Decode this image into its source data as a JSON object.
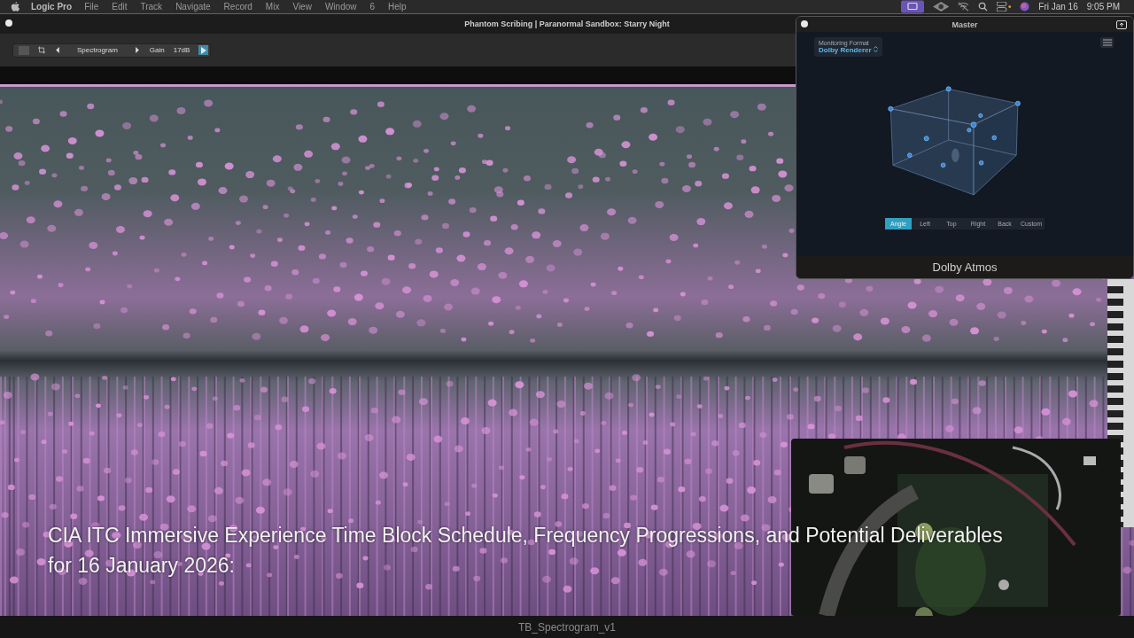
{
  "menu_bar": {
    "app": "Logic Pro",
    "menus": [
      "File",
      "Edit",
      "Track",
      "Navigate",
      "Record",
      "Mix",
      "View",
      "Window",
      "6",
      "Help"
    ],
    "date": "Fri Jan 16",
    "time": "9:05 PM"
  },
  "window": {
    "title": "Phantom Scribing | Paranormal Sandbox: Starry Night"
  },
  "plugin_header": {
    "name": "Spectrogram",
    "gain_label": "Gain",
    "gain_value": "17dB"
  },
  "caption": "CIA ITC Immersive Experience Time Block Schedule, Frequency Progressions, and Potential Deliverables for 16 January 2026:",
  "footer": {
    "filename": "TB_Spectrogram_v1"
  },
  "master": {
    "title": "Master",
    "monitoring_format": {
      "label": "Monitoring Format",
      "value": "Dolby Renderer"
    },
    "views": [
      {
        "label": "Angle",
        "selected": true
      },
      {
        "label": "Left",
        "selected": false
      },
      {
        "label": "Top",
        "selected": false
      },
      {
        "label": "Right",
        "selected": false
      },
      {
        "label": "Back",
        "selected": false
      },
      {
        "label": "Custom",
        "selected": false
      }
    ],
    "footer": "Dolby Atmos"
  }
}
